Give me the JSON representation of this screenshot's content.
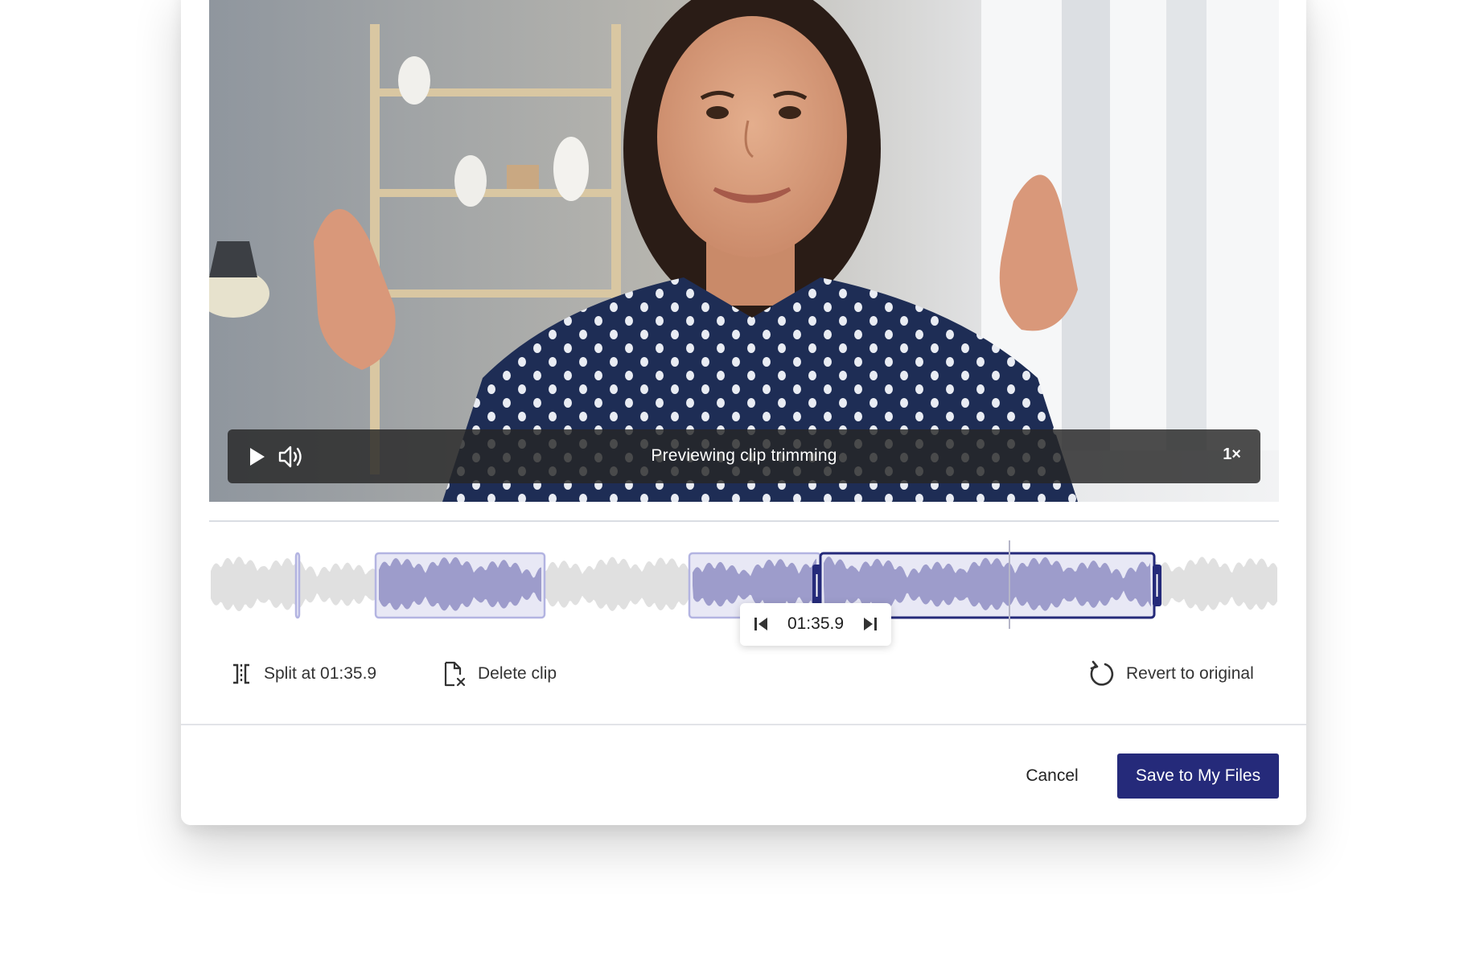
{
  "player": {
    "status_text": "Previewing clip trimming",
    "speed_label": "1×"
  },
  "timeline": {
    "playhead_time": "01:35.9"
  },
  "tools": {
    "split_label": "Split at 01:35.9",
    "delete_label": "Delete clip",
    "revert_label": "Revert to original"
  },
  "footer": {
    "cancel_label": "Cancel",
    "save_label": "Save to My Files"
  },
  "colors": {
    "accent": "#252a7a",
    "clip_fill": "#e8e8f5",
    "clip_border": "#b3b4e1",
    "wave_active": "#9d9ccb",
    "wave_inactive": "#e0e0e0"
  }
}
